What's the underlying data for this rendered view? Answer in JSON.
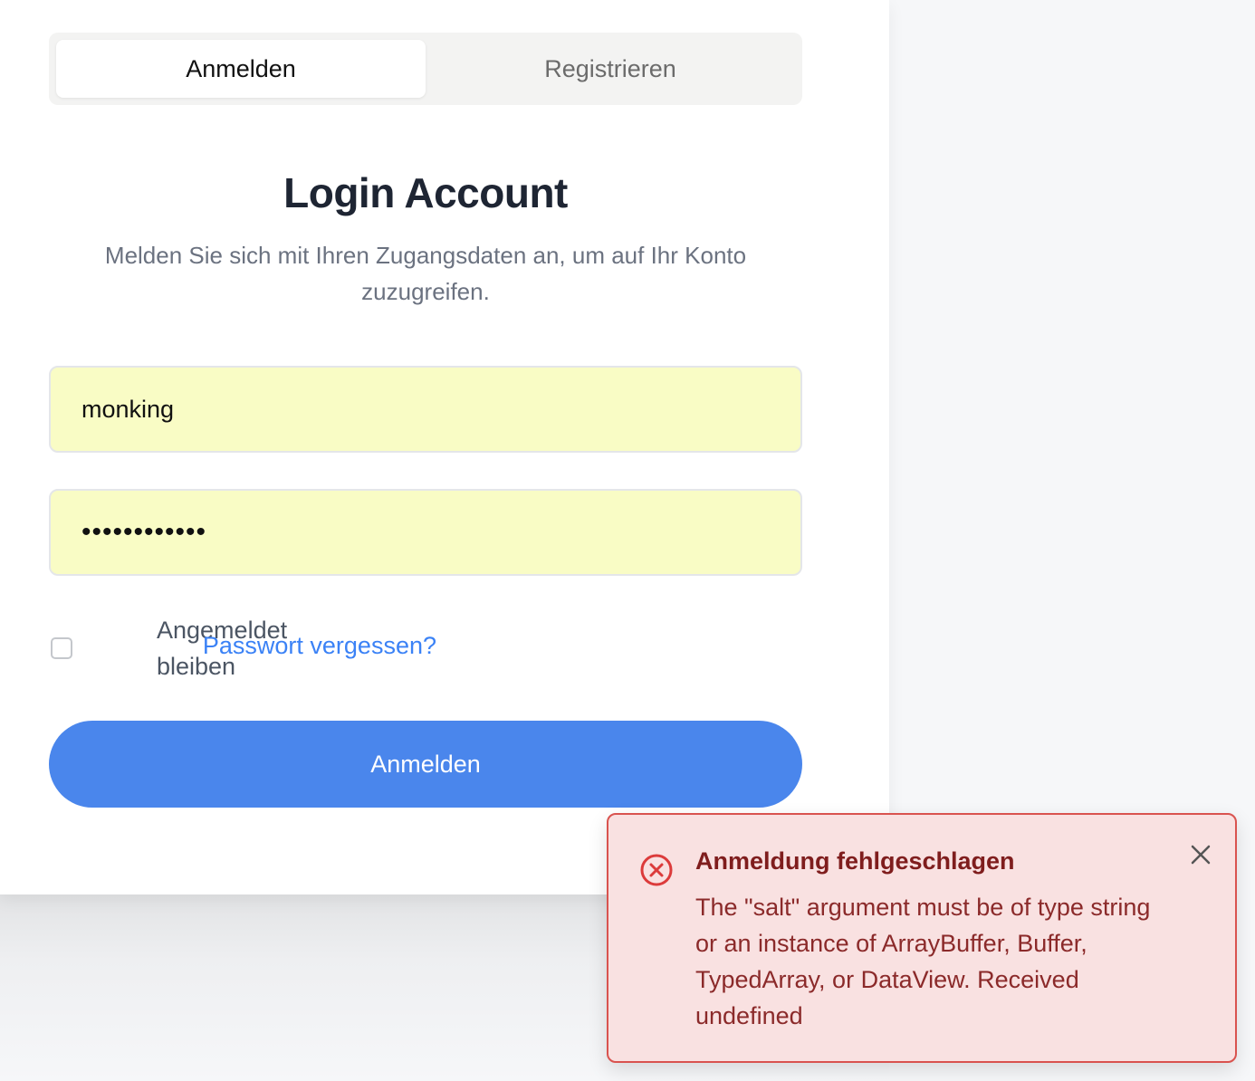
{
  "tabs": [
    {
      "label": "Anmelden",
      "active": true
    },
    {
      "label": "Registrieren",
      "active": false
    }
  ],
  "heading": {
    "title": "Login Account",
    "subtitle": "Melden Sie sich mit Ihren Zugangsdaten an, um auf Ihr Konto zuzugreifen."
  },
  "form": {
    "username_value": "monking",
    "password_value": "••••••••••••",
    "remember_label": "Angemeldet bleiben",
    "remember_checked": false,
    "forgot_label": "Passwort vergessen?",
    "submit_label": "Anmelden"
  },
  "toast": {
    "title": "Anmeldung fehlgeschlagen",
    "message": "The \"salt\" argument must be of type string or an instance of ArrayBuffer, Buffer, TypedArray, or DataView. Received undefined",
    "icon": "error-circle-x-icon",
    "close_icon": "close-icon"
  },
  "colors": {
    "accent": "#4a86ec",
    "link": "#3b82f6",
    "autofill": "#f9fcc5",
    "error_bg": "#f9e1e1",
    "error_border": "#d9534f",
    "error_text": "#7f1d1d"
  }
}
